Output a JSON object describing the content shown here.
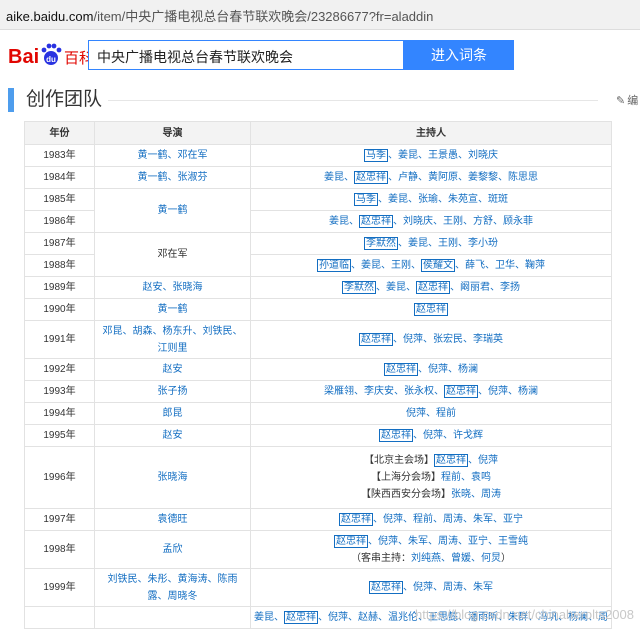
{
  "browser": {
    "url_host": "aike.baidu.com",
    "url_rest": "/item/中央广播电视总台春节联欢晚会/23286677?fr=aladdin"
  },
  "logo": {
    "text_bai": "Bai",
    "text_du": "du",
    "text_baike": "百科"
  },
  "search": {
    "value": "中央广播电视总台春节联欢晚会",
    "button": "进入词条"
  },
  "section": {
    "title": "创作团队",
    "edit": "编"
  },
  "table": {
    "headers": [
      "年份",
      "导演",
      "主持人"
    ],
    "rows": [
      {
        "year": "1983年",
        "director": "黄一鹤、邓在军",
        "hosts": [
          [
            "马季",
            "box"
          ],
          [
            "、姜昆、王景愚、刘晓庆",
            "lk"
          ]
        ]
      },
      {
        "year": "1984年",
        "director": "黄一鹤、张淑芬",
        "hosts": [
          [
            "姜昆、",
            "lk"
          ],
          [
            "赵忠祥",
            "box"
          ],
          [
            "、卢静、黄阿原、姜黎黎、陈思思",
            "lk"
          ]
        ]
      },
      {
        "year": "1985年",
        "director": "黄一鹤",
        "dspan": 2,
        "hosts": [
          [
            "马季",
            "box"
          ],
          [
            "、姜昆、张瑜、朱苑宣、斑斑",
            "lk"
          ]
        ]
      },
      {
        "year": "1986年",
        "hosts": [
          [
            "姜昆、",
            "lk"
          ],
          [
            "赵忠祥",
            "box"
          ],
          [
            "、刘晓庆、王刚、方舒、顾永菲",
            "lk"
          ]
        ]
      },
      {
        "year": "1987年",
        "director": "邓在军",
        "dspan": 2,
        "dplain": true,
        "hosts": [
          [
            "李默然",
            "box"
          ],
          [
            "、姜昆、王刚、李小玢",
            "lk"
          ]
        ]
      },
      {
        "year": "1988年",
        "hosts": [
          [
            "孙道临",
            "box"
          ],
          [
            "、姜昆、王刚、",
            "lk"
          ],
          [
            "侯耀文",
            "box"
          ],
          [
            "、薛飞、卫华、鞠萍",
            "lk"
          ]
        ]
      },
      {
        "year": "1989年",
        "director": "赵安、张晓海",
        "hosts": [
          [
            "李默然",
            "box"
          ],
          [
            "、姜昆、",
            "lk"
          ],
          [
            "赵忠祥",
            "box"
          ],
          [
            "、阚丽君、李扬",
            "lk"
          ]
        ]
      },
      {
        "year": "1990年",
        "director": "黄一鹤",
        "hosts": [
          [
            "赵忠祥",
            "box"
          ]
        ]
      },
      {
        "year": "1991年",
        "director": "邓昆、胡森、杨东升、刘铁民、江则里",
        "hosts": [
          [
            "赵忠祥",
            "box"
          ],
          [
            "、倪萍、张宏民、李瑞英",
            "lk"
          ]
        ]
      },
      {
        "year": "1992年",
        "director": "赵安",
        "hosts": [
          [
            "赵忠祥",
            "box"
          ],
          [
            "、倪萍、杨澜",
            "lk"
          ]
        ]
      },
      {
        "year": "1993年",
        "director": "张子扬",
        "hosts": [
          [
            "梁雁翎、李庆安、张永权、",
            "lk"
          ],
          [
            "赵忠祥",
            "box"
          ],
          [
            "、倪萍、杨澜",
            "lk"
          ]
        ]
      },
      {
        "year": "1994年",
        "director": "郎昆",
        "hosts": [
          [
            "倪萍、程前",
            "lk"
          ]
        ]
      },
      {
        "year": "1995年",
        "director": "赵安",
        "hosts": [
          [
            "赵忠祥",
            "box"
          ],
          [
            "、倪萍、许戈辉",
            "lk"
          ]
        ]
      },
      {
        "year": "1996年",
        "director": "张晓海",
        "hostlines": [
          [
            [
              "【北京主会场】",
              "plain"
            ],
            [
              "赵忠祥",
              "box"
            ],
            [
              "、倪萍",
              "lk"
            ]
          ],
          [
            [
              "【上海分会场】",
              "plain"
            ],
            [
              "程前、袁鸣",
              "lk"
            ]
          ],
          [
            [
              "【陕西西安分会场】",
              "plain"
            ],
            [
              "张晓、周涛",
              "lk"
            ]
          ]
        ]
      },
      {
        "year": "1997年",
        "director": "袁德旺",
        "hosts": [
          [
            "赵忠祥",
            "box"
          ],
          [
            "、倪萍、程前、周涛、朱军、亚宁",
            "lk"
          ]
        ]
      },
      {
        "year": "1998年",
        "director": "孟欣",
        "hostlines": [
          [
            [
              "赵忠祥",
              "box"
            ],
            [
              "、倪萍、朱军、周涛、亚宁、王雪纯",
              "lk"
            ]
          ],
          [
            [
              "（客串主持：",
              "plain"
            ],
            [
              "刘纯燕、曾媛、何炅",
              "lk"
            ],
            [
              "）",
              "plain"
            ]
          ]
        ]
      },
      {
        "year": "1999年",
        "director": "刘铁民、朱彤、黄海涛、陈雨露、周晓冬",
        "hosts": [
          [
            "赵忠祥",
            "box"
          ],
          [
            "、倪萍、周涛、朱军",
            "lk"
          ]
        ]
      },
      {
        "year": "",
        "director": "",
        "hosts": [
          [
            "姜昆、",
            "lk"
          ],
          [
            "赵忠祥",
            "box"
          ],
          [
            "、倪萍、赵赫、温兆伦、王思懿、潘雨昕、朱群、冯巩、杨澜、周",
            "lk"
          ]
        ]
      }
    ]
  },
  "watermark": "https://blog.csdn.net/chinaherolts2008"
}
